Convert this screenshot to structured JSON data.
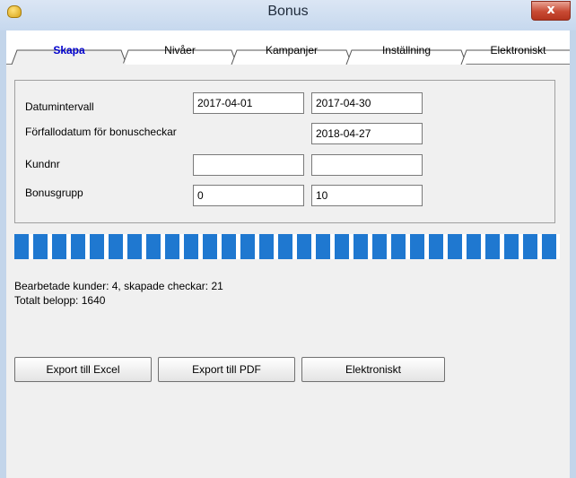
{
  "window": {
    "title": "Bonus",
    "close_glyph": "x"
  },
  "tabs": [
    {
      "label": "Skapa",
      "active": true
    },
    {
      "label": "Nivåer",
      "active": false
    },
    {
      "label": "Kampanjer",
      "active": false
    },
    {
      "label": "Inställning",
      "active": false
    },
    {
      "label": "Elektroniskt",
      "active": false
    }
  ],
  "form": {
    "date_range": {
      "label": "Datumintervall",
      "from": "2017-04-01",
      "to": "2017-04-30"
    },
    "due_date": {
      "label": "Förfallodatum för bonuscheckar",
      "value": "2018-04-27"
    },
    "customer_no": {
      "label": "Kundnr",
      "from": "",
      "to": ""
    },
    "bonus_group": {
      "label": "Bonusgrupp",
      "from": "0",
      "to": "10"
    }
  },
  "progress": {
    "fraction": 1.0,
    "color": "#1f78d0"
  },
  "status": {
    "line1": "Bearbetade kunder:  4, skapade checkar:  21",
    "line2": "Totalt belopp: 1640"
  },
  "buttons": {
    "export_excel": "Export till Excel",
    "export_pdf": "Export till PDF",
    "electronic": "Elektroniskt"
  },
  "colors": {
    "active_tab_text": "#0000cc",
    "close_button": "#c84a33",
    "titlebar": "#c6d8ee"
  }
}
